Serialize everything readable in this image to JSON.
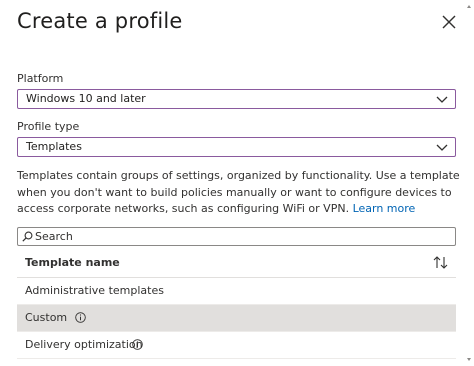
{
  "header": {
    "title": "Create a profile",
    "close_icon": "close-icon"
  },
  "platform": {
    "label": "Platform",
    "value": "Windows 10 and later"
  },
  "profile_type": {
    "label": "Profile type",
    "value": "Templates"
  },
  "description": {
    "text": "Templates contain groups of settings, organized by functionality. Use a template when you don't want to build policies manually or want to configure devices to access corporate networks, such as configuring WiFi or VPN.",
    "link": "Learn more"
  },
  "search": {
    "placeholder": "Search",
    "value": ""
  },
  "table": {
    "column_header": "Template name",
    "rows": [
      {
        "label": "Administrative templates",
        "has_info": false,
        "selected": false
      },
      {
        "label": "Custom",
        "has_info": true,
        "selected": true
      },
      {
        "label": "Delivery optimization",
        "has_info": true,
        "selected": false
      }
    ]
  },
  "colors": {
    "accent_border": "#8a5a9e",
    "link": "#0064b4",
    "selected_row": "#e1dfdd"
  }
}
